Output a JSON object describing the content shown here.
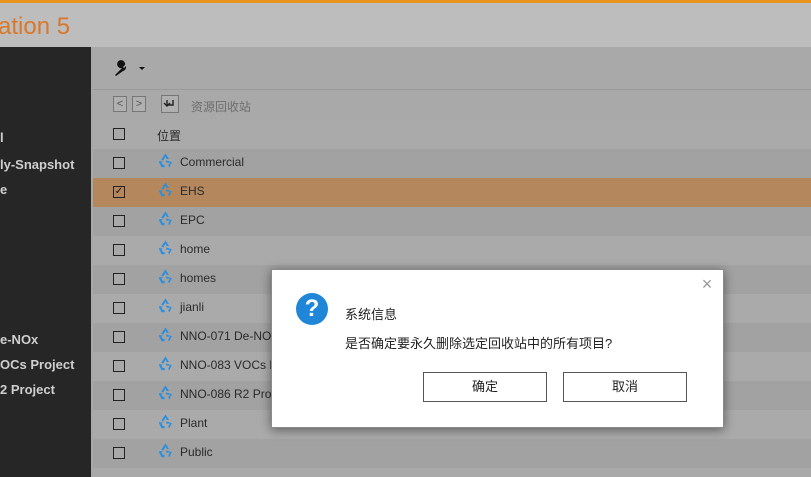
{
  "header": {
    "app_title": "ation 5"
  },
  "sidebar": {
    "items": [
      {
        "label": "l"
      },
      {
        "label": "ly-Snapshot"
      },
      {
        "label": "e"
      },
      {
        "label": "e-NOx"
      },
      {
        "label": "OCs Project"
      },
      {
        "label": "2 Project"
      }
    ]
  },
  "toolbar": {
    "tool_icon": "wrench-icon",
    "dropdown_icon": "caret-down-icon"
  },
  "nav": {
    "back": "<",
    "forward": ">",
    "undo_icon": "undo-arrow-icon",
    "label": "资源回收站"
  },
  "table": {
    "header": "位置",
    "rows": [
      {
        "name": "Commercial",
        "checked": false
      },
      {
        "name": "EHS",
        "checked": true
      },
      {
        "name": "EPC",
        "checked": false
      },
      {
        "name": "home",
        "checked": false
      },
      {
        "name": "homes",
        "checked": false
      },
      {
        "name": "jianli",
        "checked": false
      },
      {
        "name": "NNO-071 De-NOx",
        "checked": false
      },
      {
        "name": "NNO-083 VOCs P",
        "checked": false
      },
      {
        "name": "NNO-086 R2 Proj",
        "checked": false
      },
      {
        "name": "Plant",
        "checked": false
      },
      {
        "name": "Public",
        "checked": false
      }
    ],
    "check_mark": "✓"
  },
  "dialog": {
    "title": "系统信息",
    "message": "是否确定要永久删除选定回收站中的所有项目?",
    "confirm_label": "确定",
    "cancel_label": "取消",
    "close": "×",
    "question_mark": "?"
  },
  "colors": {
    "accent": "#e8951f",
    "selected_row": "#b4885c",
    "question_icon": "#1f86d8"
  }
}
